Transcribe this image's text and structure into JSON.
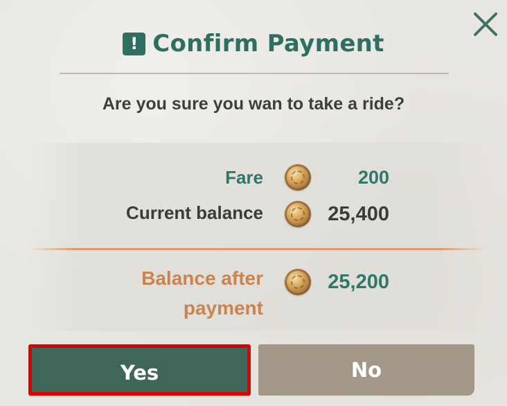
{
  "dialog": {
    "title": "Confirm Payment",
    "title_icon": "exclamation-icon",
    "question": "Are you sure you wan to take a ride?",
    "close_icon": "close-icon"
  },
  "payment": {
    "fare_label": "Fare",
    "fare_value": "200",
    "current_balance_label": "Current balance",
    "current_balance_value": "25,400",
    "balance_after_label_line1": "Balance after",
    "balance_after_label_line2": "payment",
    "balance_after_value": "25,200",
    "currency_icon": "coin-icon"
  },
  "buttons": {
    "yes_label": "Yes",
    "no_label": "No"
  },
  "colors": {
    "accent_teal": "#2f6f62",
    "yes_button": "#3e6659",
    "no_button": "#a39787",
    "after_payment_text": "#c98450",
    "highlight_border": "#e00000"
  }
}
